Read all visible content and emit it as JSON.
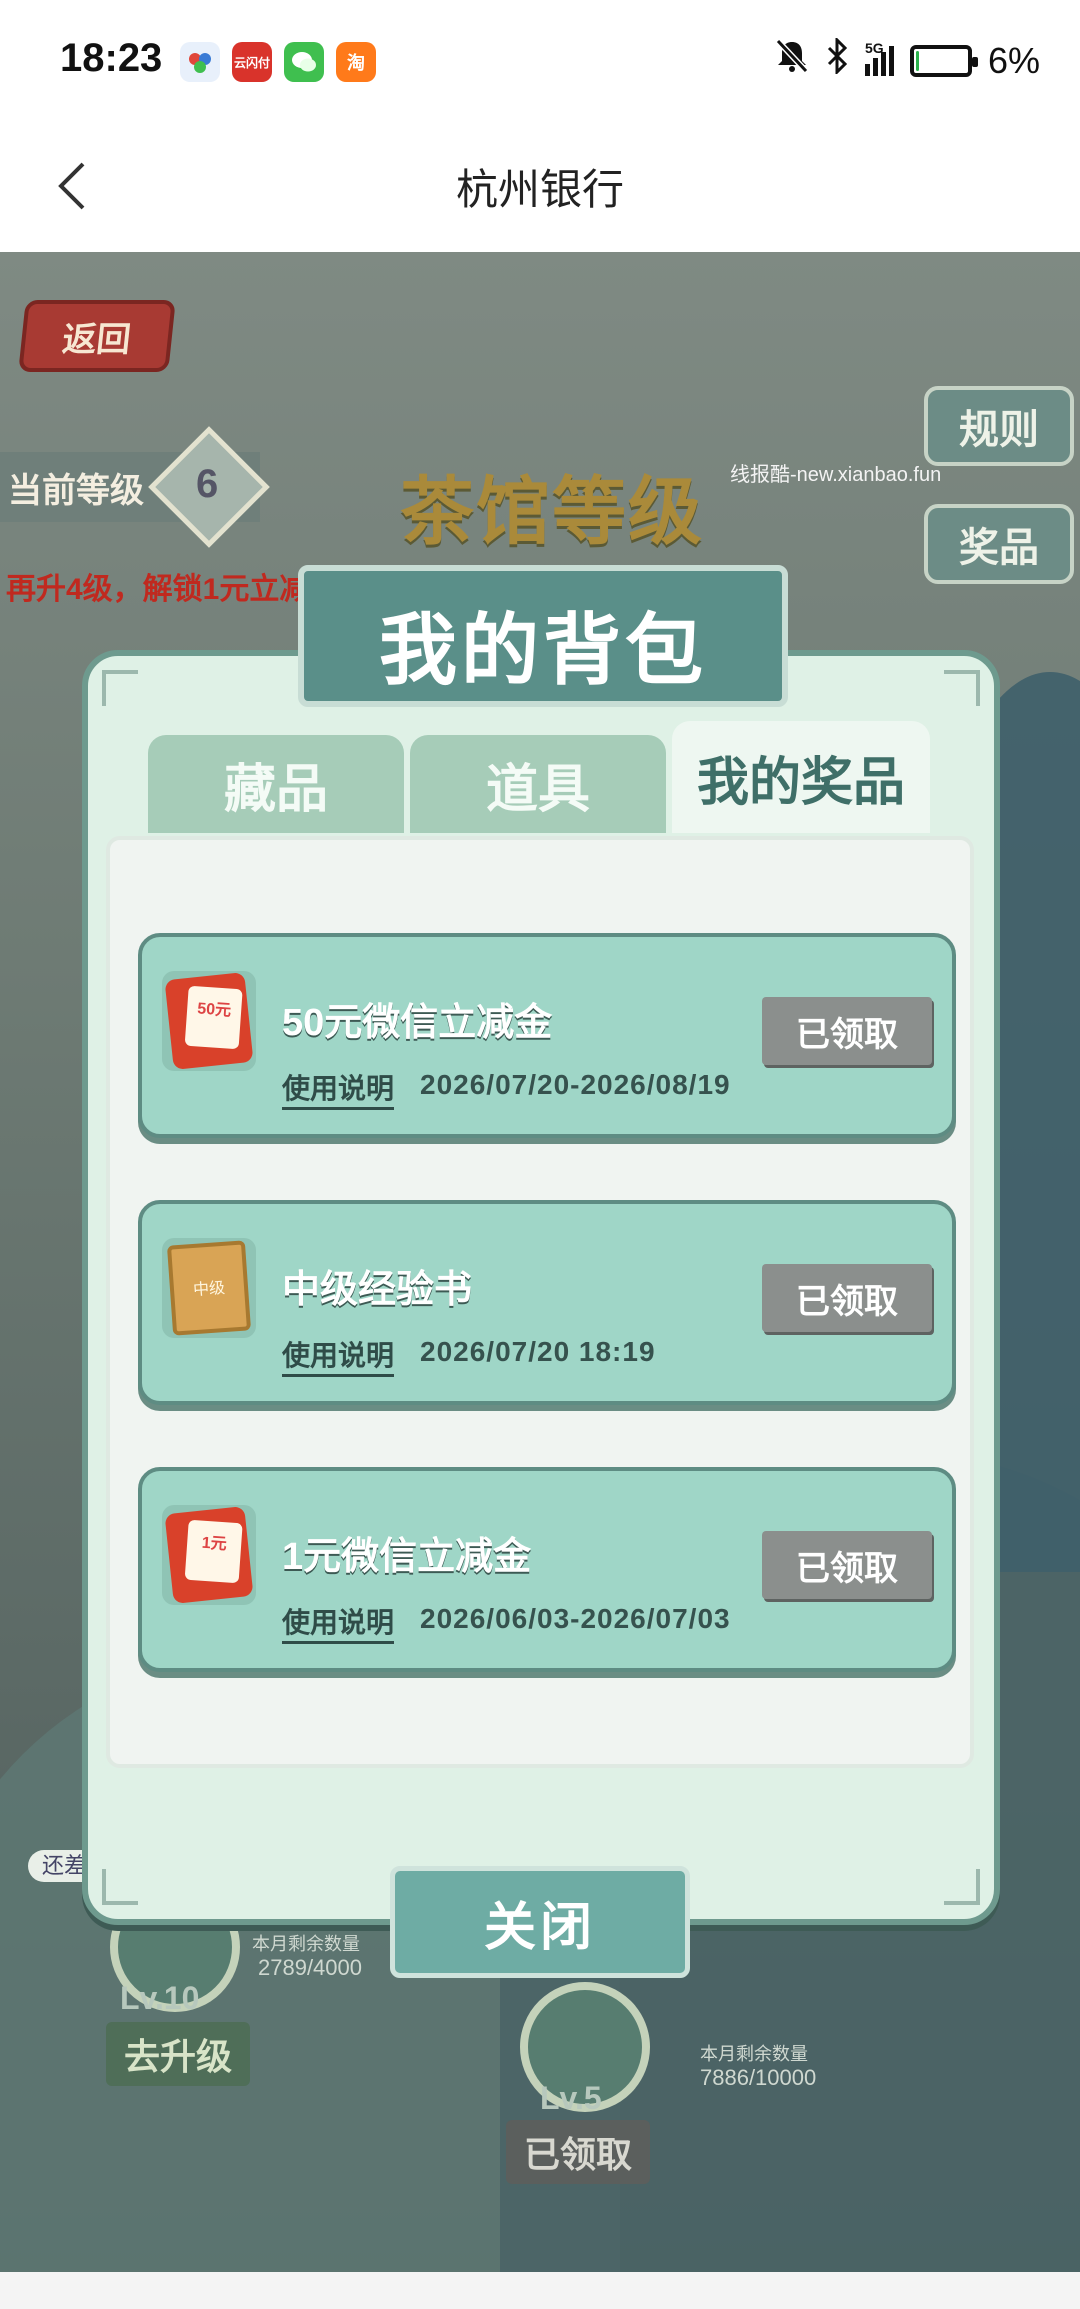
{
  "status_bar": {
    "time": "18:23",
    "apps": [
      {
        "icon": "cloudflash-app-icon",
        "label": "",
        "color": "#3a7bd5"
      },
      {
        "icon": "yunshanfu-app-icon",
        "label": "云闪付",
        "color": "#d9332b"
      },
      {
        "icon": "wechat-app-icon",
        "label": "",
        "color": "#3fbf4f"
      },
      {
        "icon": "taobao-app-icon",
        "label": "淘",
        "color": "#ff7a1a"
      }
    ],
    "network": "5G",
    "battery_level": 0.06,
    "battery_text": "6%"
  },
  "nav": {
    "title": "杭州银行"
  },
  "game": {
    "return_label": "返回",
    "current_level_label": "当前等级",
    "current_level": "6",
    "hint": "再升4级，解锁1元立减",
    "title": "茶馆等级",
    "rules_label": "规则",
    "prizes_label": "奖品",
    "watermark": "线报酷-new.xianbao.fun",
    "level10_label": "Lv.10",
    "level10_button": "去升级",
    "level10_remaining": "本月剩余数量",
    "level10_count": "2789/4000",
    "level5_label": "Lv.5",
    "level5_button": "已领取",
    "level5_remaining": "本月剩余数量",
    "level5_count": "7886/10000",
    "still_need": "还差"
  },
  "modal": {
    "title": "我的背包",
    "tabs": [
      {
        "label": "藏品",
        "active": false
      },
      {
        "label": "道具",
        "active": false
      },
      {
        "label": "我的奖品",
        "active": true
      }
    ],
    "prizes": [
      {
        "name": "50元微信立减金",
        "icon": "red-envelope-icon",
        "icon_text": "50元",
        "help": "使用说明",
        "date": "2026/07/20-2026/08/19",
        "status": "已领取"
      },
      {
        "name": "中级经验书",
        "icon": "experience-book-icon",
        "icon_text": "中级",
        "help": "使用说明",
        "date": "2026/07/20 18:19",
        "status": "已领取"
      },
      {
        "name": "1元微信立减金",
        "icon": "red-envelope-icon",
        "icon_text": "1元",
        "help": "使用说明",
        "date": "2026/06/03-2026/07/03",
        "status": "已领取"
      }
    ],
    "close_label": "关闭"
  }
}
